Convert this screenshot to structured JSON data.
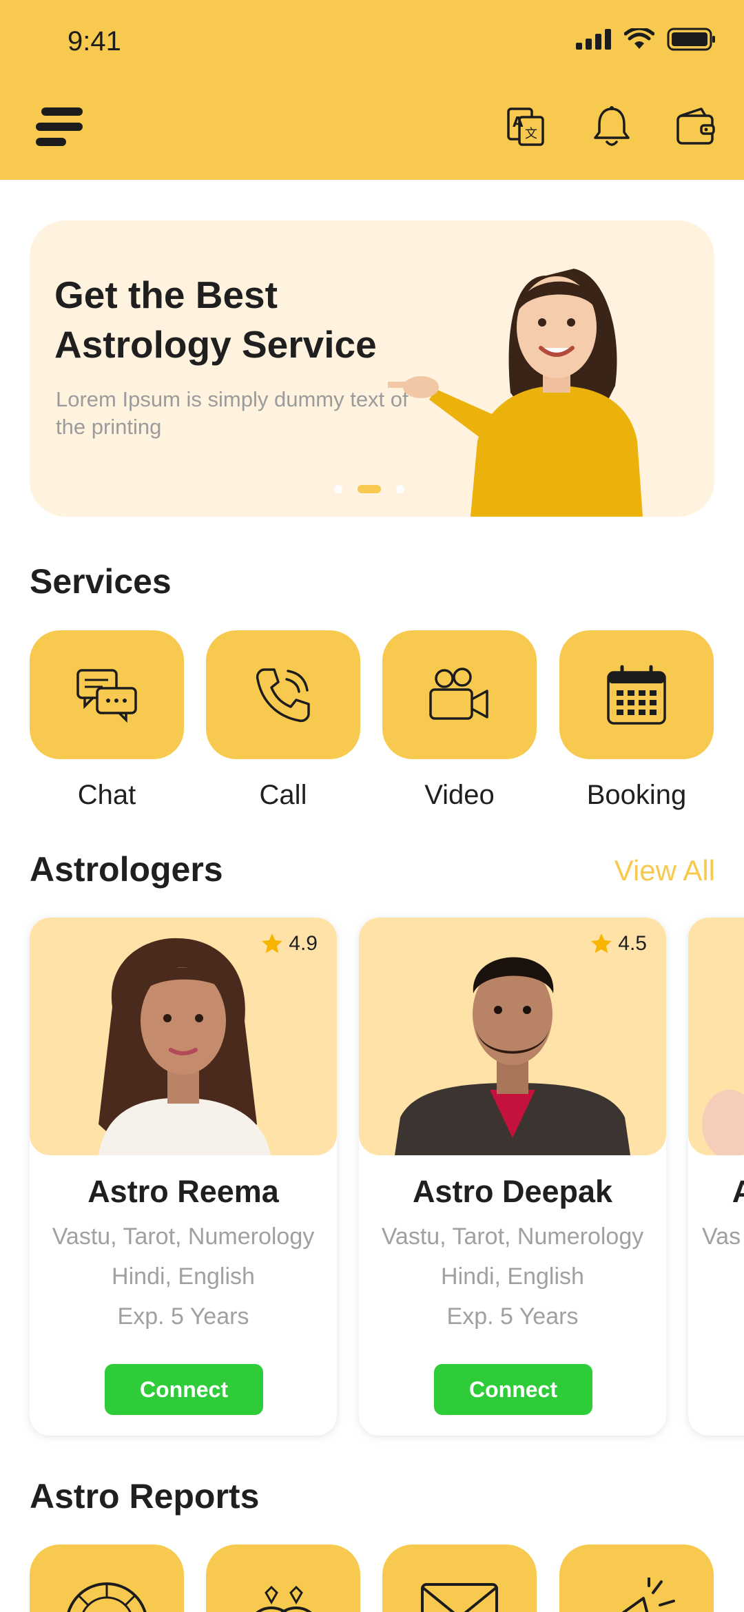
{
  "status_bar": {
    "time": "9:41"
  },
  "banner": {
    "title": "Get the Best Astrology Service",
    "subtitle": "Lorem Ipsum is simply dummy text of the printing"
  },
  "services": {
    "title": "Services",
    "items": [
      {
        "label": "Chat",
        "icon": "chat-icon"
      },
      {
        "label": "Call",
        "icon": "phone-icon"
      },
      {
        "label": "Video",
        "icon": "video-camera-icon"
      },
      {
        "label": "Booking",
        "icon": "calendar-icon"
      }
    ]
  },
  "astrologers": {
    "title": "Astrologers",
    "view_all": "View All",
    "cards": [
      {
        "name": "Astro Reema",
        "skills": "Vastu, Tarot, Numerology",
        "languages": "Hindi, English",
        "experience": "Exp. 5 Years",
        "rating": "4.9",
        "connect": "Connect"
      },
      {
        "name": "Astro Deepak",
        "skills": "Vastu, Tarot, Numerology",
        "languages": "Hindi, English",
        "experience": "Exp. 5 Years",
        "rating": "4.5",
        "connect": "Connect"
      },
      {
        "name": "A",
        "skills": "Vas",
        "languages": "",
        "experience": "",
        "rating": "",
        "connect": ""
      }
    ]
  },
  "reports": {
    "title": "Astro Reports"
  },
  "colors": {
    "accent": "#F7C94F",
    "banner_bg": "#FFF3DF",
    "photo_bg": "#FFE2A8",
    "connect": "#2FCC3A"
  }
}
